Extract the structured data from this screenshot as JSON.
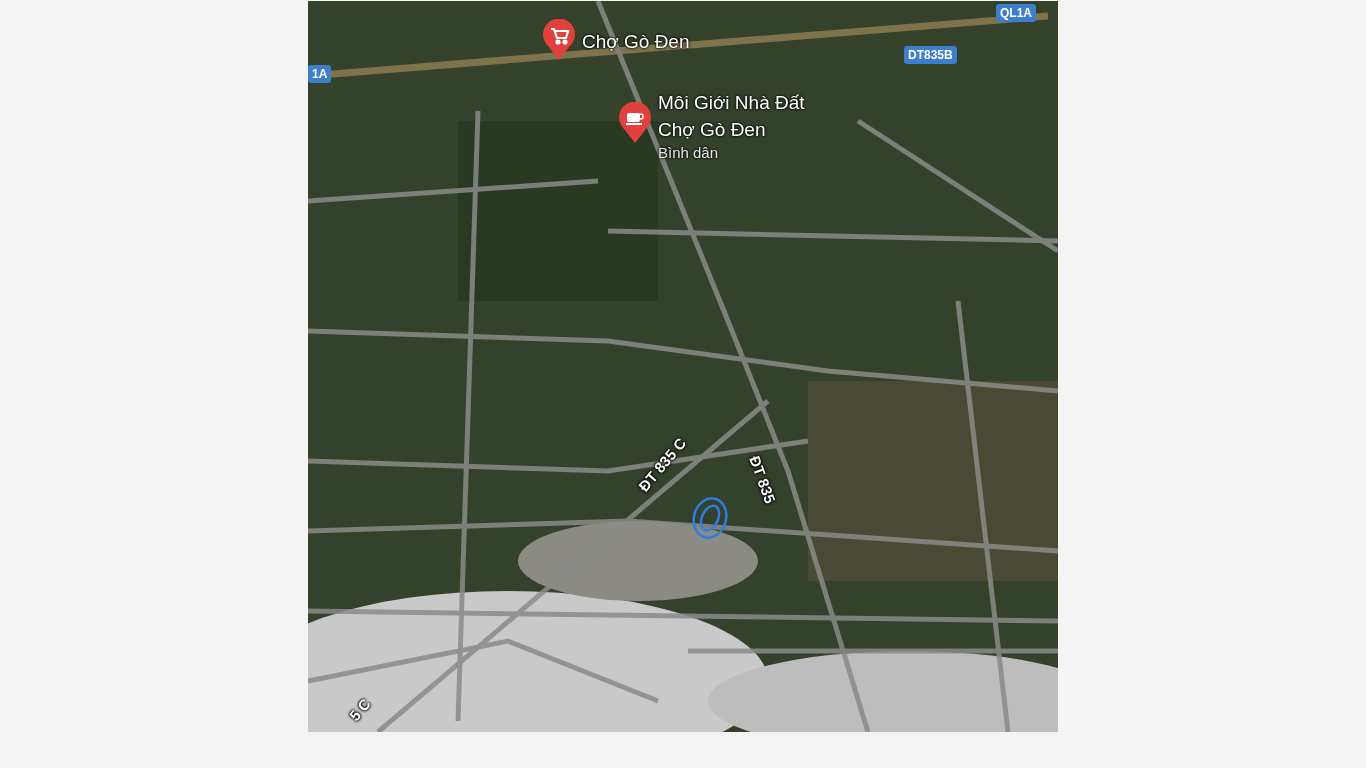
{
  "map": {
    "places": [
      {
        "kind": "shop",
        "lines": [
          "Chợ Gò Đen"
        ]
      },
      {
        "kind": "cafe",
        "lines": [
          "Môi Giới Nhà Đất",
          "Chợ Gò Đen"
        ],
        "subtitle": "Bình dân"
      }
    ],
    "shields": [
      "QL1A",
      "DT835B",
      "1A"
    ],
    "road_labels": [
      "ĐT 835 C",
      "ĐT 835",
      "5 C"
    ]
  }
}
